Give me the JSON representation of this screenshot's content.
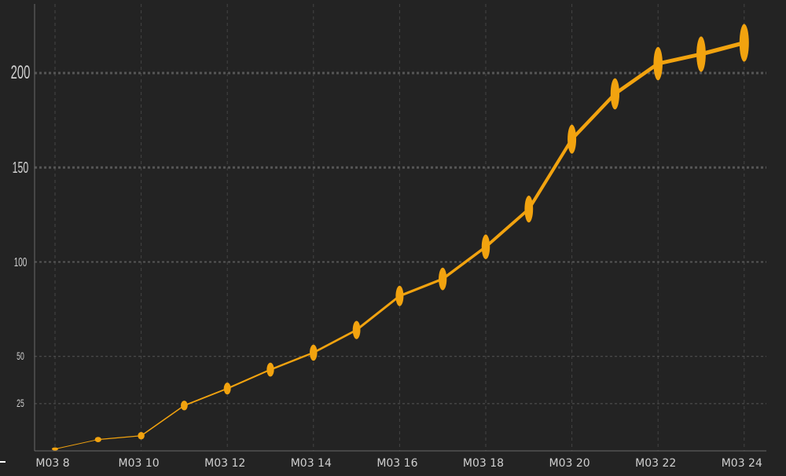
{
  "chart_data": {
    "type": "line",
    "x": [
      "M03 8",
      "M03 9",
      "M03 10",
      "M03 11",
      "M03 12",
      "M03 13",
      "M03 14",
      "M03 15",
      "M03 16",
      "M03 17",
      "M03 18",
      "M03 19",
      "M03 20",
      "M03 21",
      "M03 22",
      "M03 23",
      "M03 24"
    ],
    "x_tick_labels": [
      "M03 8",
      "M03 10",
      "M03 12",
      "M03 14",
      "M03 16",
      "M03 18",
      "M03 20",
      "M03 22",
      "M03 24"
    ],
    "series": [
      {
        "values": [
          1,
          6,
          8,
          24,
          33,
          43,
          52,
          64,
          82,
          91,
          108,
          128,
          165,
          189,
          205,
          210,
          216
        ]
      }
    ],
    "y_ticks": [
      25,
      50,
      100,
      150,
      200
    ],
    "ylim": [
      0,
      220
    ],
    "grid": true,
    "color": "#f2a30f"
  }
}
